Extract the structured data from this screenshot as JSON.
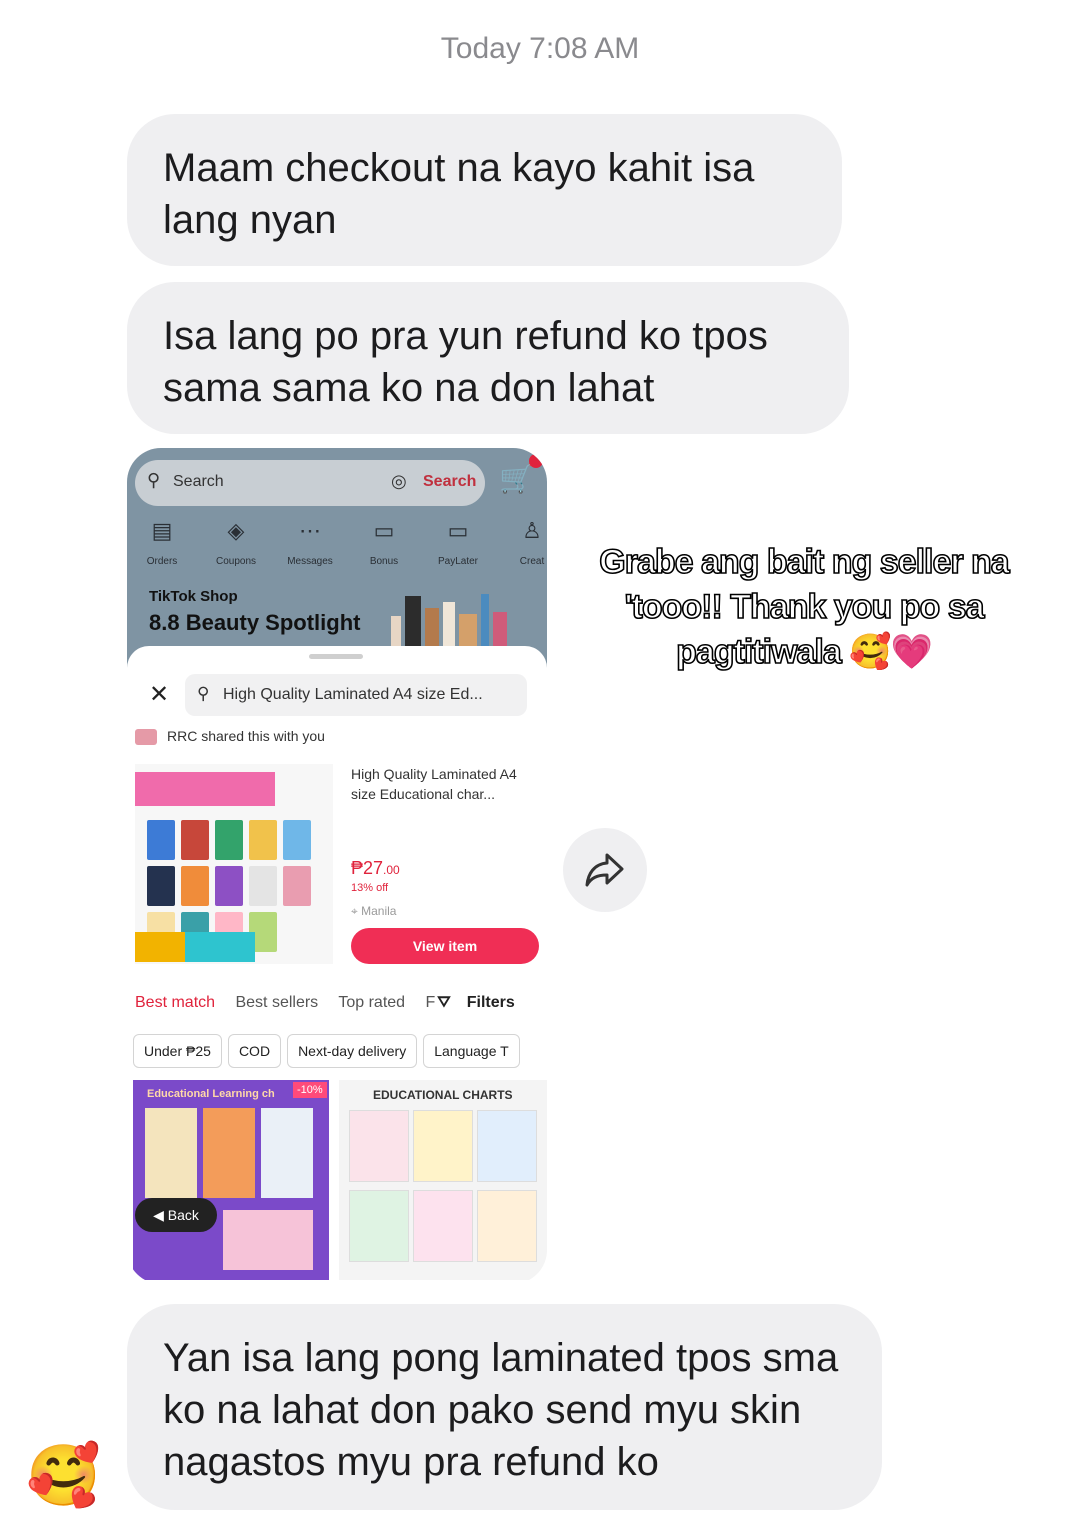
{
  "thread": {
    "timestamp": "Today 7:08 AM",
    "messages": [
      "Maam checkout na kayo kahit  isa lang nyan",
      "Isa lang po pra yun refund ko tpos sama sama ko na don lahat",
      "Yan isa lang pong laminated tpos sma ko na lahat don pako send myu skin nagastos myu pra refund ko"
    ],
    "reaction_emoji": "🥰",
    "overlay_caption": "Grabe ang bait ng seller na 'tooo!! Thank you po sa pagtitiwala 🥰💗"
  },
  "screenshot": {
    "search_placeholder": "Search",
    "search_button": "Search",
    "icons": [
      {
        "label": "Orders",
        "glyph": "▤"
      },
      {
        "label": "Coupons",
        "glyph": "◈"
      },
      {
        "label": "Messages",
        "glyph": "⋯"
      },
      {
        "label": "Bonus",
        "glyph": "▭"
      },
      {
        "label": "PayLater",
        "glyph": "▭"
      },
      {
        "label": "Creat",
        "glyph": "♙"
      }
    ],
    "shop_brand": "TikTok Shop",
    "banner_title": "8.8 Beauty Spotlight",
    "sheet": {
      "query": "High Quality Laminated A4 size Ed...",
      "shared_by": "RRC shared this with you",
      "product_title": "High Quality Laminated A4 size Educational char...",
      "price_symbol": "₱",
      "price_main": "27",
      "price_cents": ".00",
      "discount": "13% off",
      "location": "Manila",
      "view_button": "View item",
      "sort_tabs": [
        "Best match",
        "Best sellers",
        "Top rated",
        "F"
      ],
      "filters_label": "Filters",
      "chips": [
        "Under ₱25",
        "COD",
        "Next-day delivery",
        "Language T"
      ],
      "grid_left_title": "Educational Learning ch",
      "grid_left_discount": "-10%",
      "grid_right_title": "EDUCATIONAL CHARTS",
      "back_label": "Back"
    }
  },
  "colors": {
    "bubble": "#efeff1",
    "accent_red": "#e0233c",
    "view_button": "#f02e55"
  }
}
